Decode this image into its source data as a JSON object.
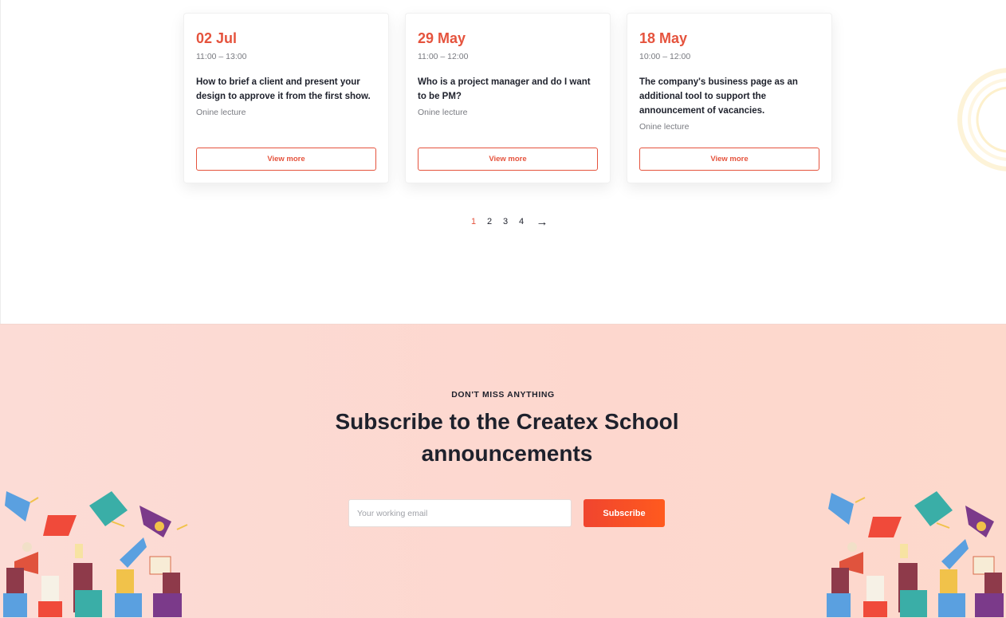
{
  "events": {
    "cards": [
      {
        "date": "02 Jul",
        "time": "11:00 – 13:00",
        "title": "How to brief a client and present your design to approve it from the first show.",
        "type": "Onine  lecture",
        "button": "View more"
      },
      {
        "date": "29 May",
        "time": "11:00 – 12:00",
        "title": "Who is a project manager and do I want to be PM?",
        "type": "Onine lecture",
        "button": "View more"
      },
      {
        "date": "18 May",
        "time": "10:00 – 12:00",
        "title": "The company's business page as an additional tool to support the announcement of vacancies.",
        "type": "Onine lecture",
        "button": "View more"
      }
    ],
    "pagination": {
      "pages": [
        "1",
        "2",
        "3",
        "4"
      ],
      "current": "1",
      "next_icon": "arrow-right-icon",
      "next_glyph": "→"
    }
  },
  "subscribe": {
    "eyebrow": "DON'T MISS ANYTHING",
    "title": "Subscribe to the Createx School announcements",
    "email_placeholder": "Your working email",
    "button": "Subscribe"
  },
  "colors": {
    "accent": "#e5533d",
    "subscribe_bg": "#fcdcd6",
    "button_gradient_start": "#f0452f",
    "button_gradient_end": "#ff5a1e",
    "text_dark": "#1e212c",
    "text_muted": "#787a80"
  },
  "decorations": {
    "left_illustration": "graduation-caps-illustration",
    "right_illustration": "graduation-caps-illustration",
    "rings": "decorative-rings"
  }
}
